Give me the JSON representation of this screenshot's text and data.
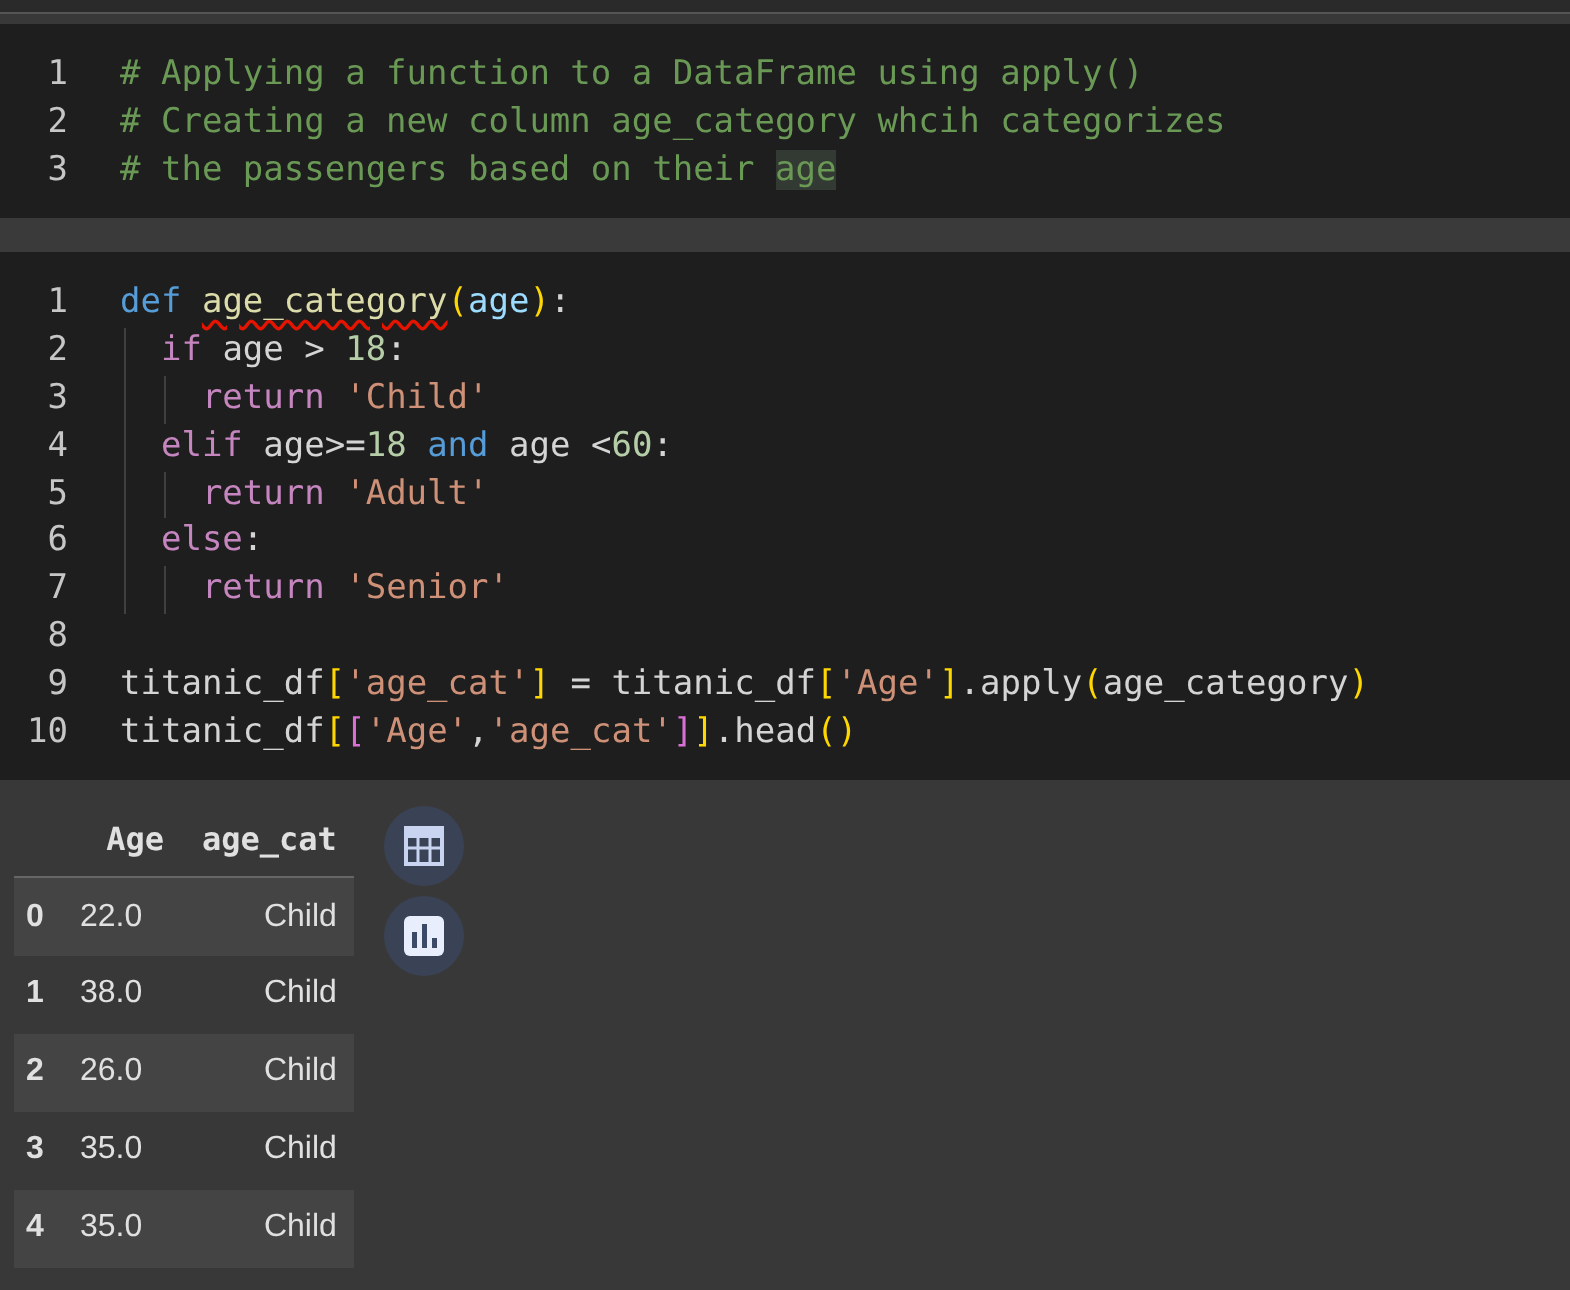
{
  "cells": [
    {
      "lines": [
        {
          "number": "1",
          "tokens": [
            {
              "t": "# Applying a function to a DataFrame using apply()",
              "kind": "comment"
            }
          ]
        },
        {
          "number": "2",
          "tokens": [
            {
              "t": "# Creating a new column age_category whcih categorizes",
              "kind": "comment"
            }
          ]
        },
        {
          "number": "3",
          "tokens": [
            {
              "t": "# the passengers based on their ",
              "kind": "comment"
            },
            {
              "t": "age",
              "kind": "comment",
              "highlighted": true
            }
          ]
        }
      ]
    },
    {
      "lines": [
        {
          "number": "1",
          "tokens": [
            {
              "t": "def ",
              "kind": "def"
            },
            {
              "t": "age_category",
              "kind": "fn",
              "flagged": true
            },
            {
              "t": "(",
              "kind": "b1"
            },
            {
              "t": "age",
              "kind": "param"
            },
            {
              "t": ")",
              "kind": "b1"
            },
            {
              "t": ":",
              "kind": "plain"
            }
          ]
        },
        {
          "number": "2",
          "tokens": [
            {
              "t": "  if",
              "kind": "kw"
            },
            {
              "t": " age > ",
              "kind": "plain"
            },
            {
              "t": "18",
              "kind": "num"
            },
            {
              "t": ":",
              "kind": "plain"
            }
          ]
        },
        {
          "number": "3",
          "tokens": [
            {
              "t": "    return ",
              "kind": "kw"
            },
            {
              "t": "'Child'",
              "kind": "str"
            }
          ]
        },
        {
          "number": "4",
          "tokens": [
            {
              "t": "  elif",
              "kind": "kw"
            },
            {
              "t": " age>=",
              "kind": "plain"
            },
            {
              "t": "18",
              "kind": "num"
            },
            {
              "t": " and",
              "kind": "def"
            },
            {
              "t": " age <",
              "kind": "plain"
            },
            {
              "t": "60",
              "kind": "num"
            },
            {
              "t": ":",
              "kind": "plain"
            }
          ]
        },
        {
          "number": "5",
          "tokens": [
            {
              "t": "    return ",
              "kind": "kw"
            },
            {
              "t": "'Adult'",
              "kind": "str"
            }
          ]
        },
        {
          "number": "6",
          "tokens": [
            {
              "t": "  else",
              "kind": "kw"
            },
            {
              "t": ":",
              "kind": "plain"
            }
          ]
        },
        {
          "number": "7",
          "tokens": [
            {
              "t": "    return ",
              "kind": "kw"
            },
            {
              "t": "'Senior'",
              "kind": "str"
            }
          ]
        },
        {
          "number": "8"
        },
        {
          "number": "9",
          "tokens": [
            {
              "t": "titanic_df",
              "kind": "plain"
            },
            {
              "t": "[",
              "kind": "b1"
            },
            {
              "t": "'age_cat'",
              "kind": "str"
            },
            {
              "t": "]",
              "kind": "b1"
            },
            {
              "t": " = titanic_df",
              "kind": "plain"
            },
            {
              "t": "[",
              "kind": "b1"
            },
            {
              "t": "'Age'",
              "kind": "str"
            },
            {
              "t": "]",
              "kind": "b1"
            },
            {
              "t": ".apply",
              "kind": "plain"
            },
            {
              "t": "(",
              "kind": "b1"
            },
            {
              "t": "age_category",
              "kind": "plain"
            },
            {
              "t": ")",
              "kind": "b1"
            }
          ]
        },
        {
          "number": "10",
          "tokens": [
            {
              "t": "titanic_df",
              "kind": "plain"
            },
            {
              "t": "[",
              "kind": "b1"
            },
            {
              "t": "[",
              "kind": "b2"
            },
            {
              "t": "'Age'",
              "kind": "str"
            },
            {
              "t": ",",
              "kind": "plain"
            },
            {
              "t": "'age_cat'",
              "kind": "str"
            },
            {
              "t": "]",
              "kind": "b2"
            },
            {
              "t": "]",
              "kind": "b1"
            },
            {
              "t": ".head",
              "kind": "plain"
            },
            {
              "t": "()",
              "kind": "b1"
            }
          ]
        }
      ]
    }
  ],
  "output": {
    "columns": [
      "Age",
      "age_cat"
    ],
    "rows": [
      {
        "index": "0",
        "values": [
          "22.0",
          "Child"
        ]
      },
      {
        "index": "1",
        "values": [
          "38.0",
          "Child"
        ]
      },
      {
        "index": "2",
        "values": [
          "26.0",
          "Child"
        ]
      },
      {
        "index": "3",
        "values": [
          "35.0",
          "Child"
        ]
      },
      {
        "index": "4",
        "values": [
          "35.0",
          "Child"
        ]
      }
    ]
  }
}
